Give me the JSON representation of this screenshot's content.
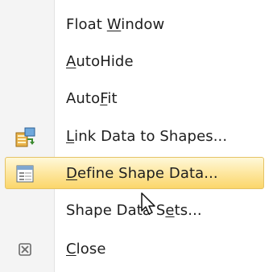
{
  "menu": {
    "items": [
      {
        "pre": "Float ",
        "key": "W",
        "post": "indow",
        "icon": null
      },
      {
        "pre": "",
        "key": "A",
        "post": "utoHide",
        "icon": null
      },
      {
        "pre": "Auto",
        "key": "F",
        "post": "it",
        "icon": null
      },
      {
        "pre": "",
        "key": "L",
        "post": "ink Data to Shapes...",
        "icon": "link-data-icon"
      },
      {
        "pre": "",
        "key": "D",
        "post": "efine Shape Data...",
        "icon": "define-shape-data-icon",
        "highlighted": true
      },
      {
        "pre": "Shape Data S",
        "key": "e",
        "post": "ts...",
        "icon": null
      },
      {
        "pre": "",
        "key": "C",
        "post": "lose",
        "icon": "close-icon"
      }
    ]
  },
  "colors": {
    "highlight_border": "#e5c365",
    "highlight_fill": "#fde59a",
    "gutter": "#f4f4f4",
    "text": "#1e1e1e"
  },
  "cursor": {
    "icon": "mouse-pointer-icon"
  }
}
